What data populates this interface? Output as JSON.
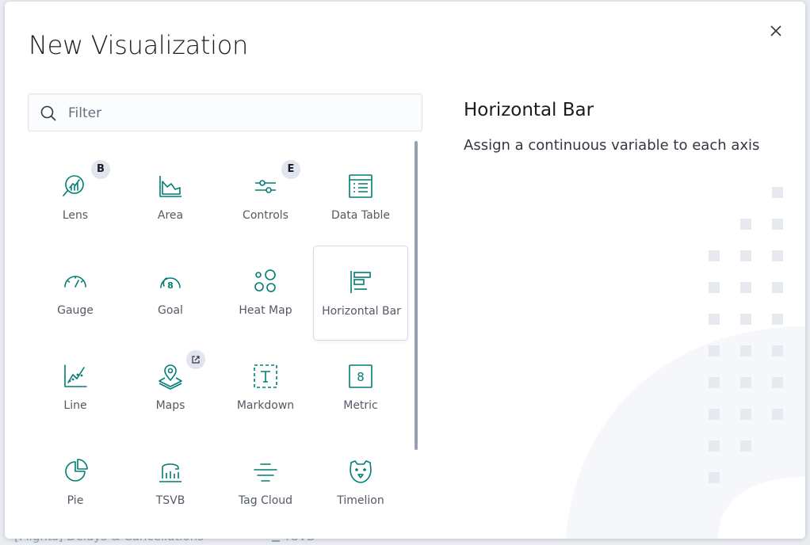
{
  "background": {
    "row_text": "[Flights] Delays & Cancellations",
    "row_type": "TSVB"
  },
  "modal": {
    "title": "New Visualization",
    "close_icon": "close-icon"
  },
  "search": {
    "placeholder": "Filter",
    "value": "",
    "icon": "search-icon"
  },
  "visualizations": [
    {
      "label": "Lens",
      "icon": "lens-icon",
      "badge": "B"
    },
    {
      "label": "Area",
      "icon": "area-chart-icon"
    },
    {
      "label": "Controls",
      "icon": "controls-icon",
      "badge": "E"
    },
    {
      "label": "Data Table",
      "icon": "data-table-icon"
    },
    {
      "label": "Gauge",
      "icon": "gauge-icon"
    },
    {
      "label": "Goal",
      "icon": "goal-icon"
    },
    {
      "label": "Heat Map",
      "icon": "heatmap-icon"
    },
    {
      "label": "Horizontal Bar",
      "icon": "horizontal-bar-icon",
      "selected": true
    },
    {
      "label": "Line",
      "icon": "line-chart-icon"
    },
    {
      "label": "Maps",
      "icon": "maps-icon",
      "badge_icon": "external-link-icon"
    },
    {
      "label": "Markdown",
      "icon": "markdown-icon"
    },
    {
      "label": "Metric",
      "icon": "metric-icon"
    },
    {
      "label": "Pie",
      "icon": "pie-chart-icon"
    },
    {
      "label": "TSVB",
      "icon": "tsvb-icon"
    },
    {
      "label": "Tag Cloud",
      "icon": "tag-cloud-icon"
    },
    {
      "label": "Timelion",
      "icon": "timelion-icon"
    }
  ],
  "detail": {
    "title": "Horizontal Bar",
    "description": "Assign a continuous variable to each axis"
  },
  "colors": {
    "accent": "#017d73",
    "text": "#343741",
    "badge": "#e0e5ee"
  }
}
